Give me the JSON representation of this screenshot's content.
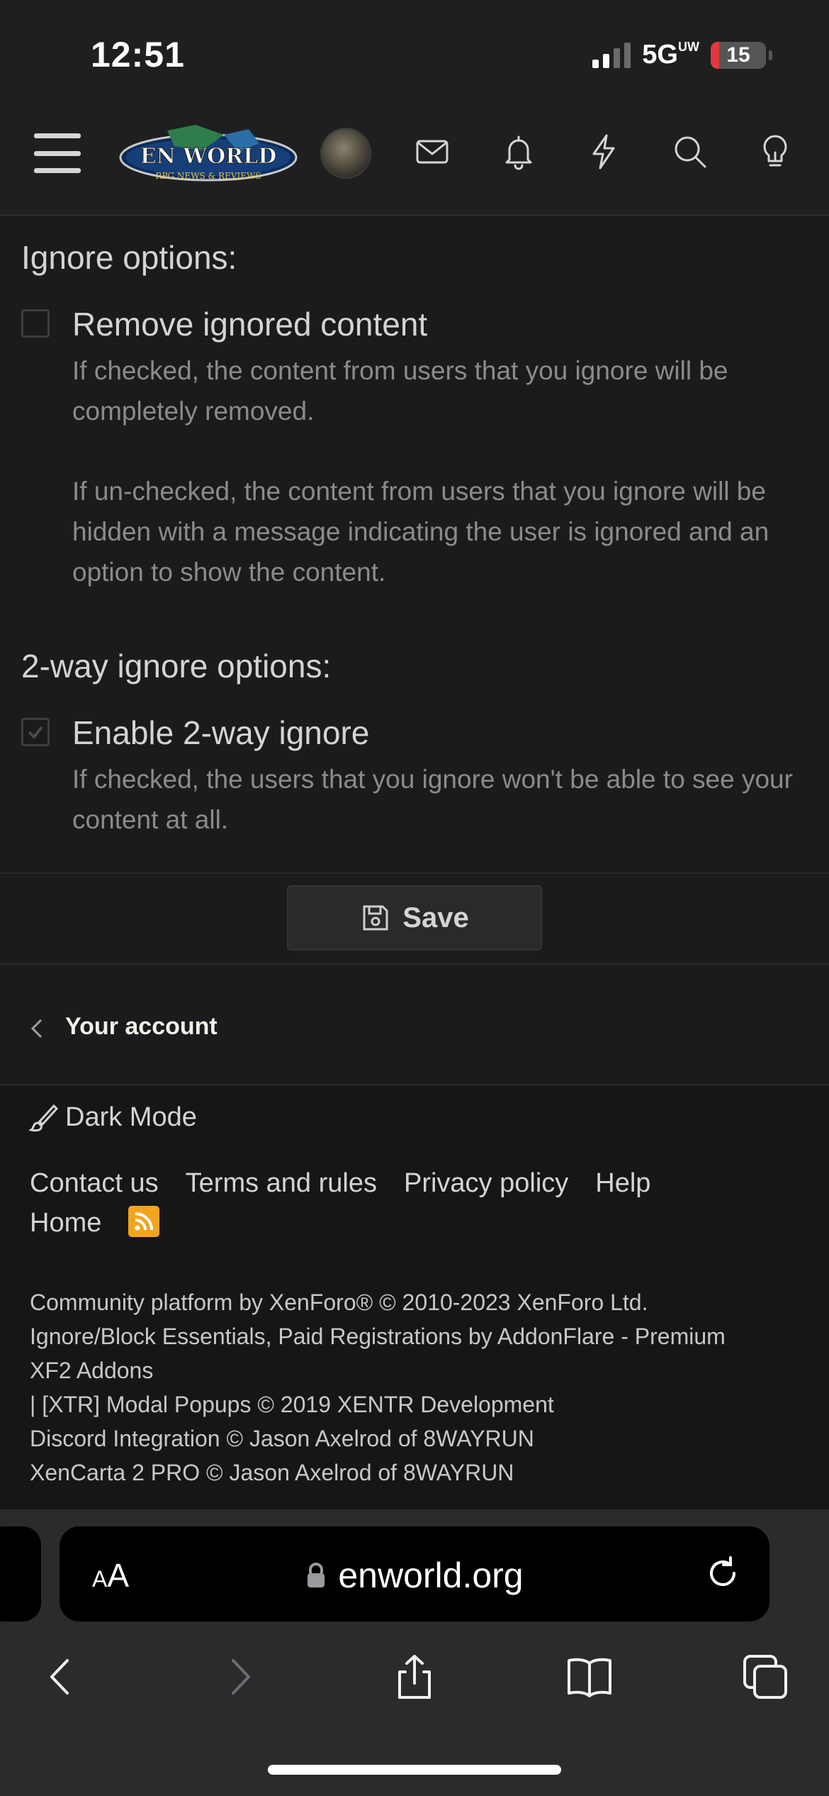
{
  "status_bar": {
    "time": "12:51",
    "network": "5G",
    "network_sup": "UW",
    "battery_percent": 15,
    "battery_label": "15"
  },
  "header": {
    "logo_alt": "EN WORLD RPG NEWS & REVIEWS",
    "icons": [
      "menu-icon",
      "avatar",
      "mail-icon",
      "bell-icon",
      "bolt-icon",
      "search-icon",
      "lightbulb-icon"
    ]
  },
  "ignore_options": {
    "title": "Ignore options:",
    "remove_label": "Remove ignored content",
    "remove_checked": false,
    "remove_desc_1": "If checked, the content from users that you ignore will be completely removed.",
    "remove_desc_2": "If un-checked, the content from users that you ignore will be hidden with a message indicating the user is ignored and an option to show the content."
  },
  "two_way": {
    "title": "2-way ignore options:",
    "enable_label": "Enable 2-way ignore",
    "enable_checked": true,
    "enable_desc": "If checked, the users that you ignore won't be able to see your content at all."
  },
  "actions": {
    "save_label": "Save"
  },
  "breadcrumb": {
    "account_label": "Your account"
  },
  "footer": {
    "dark_mode_label": "Dark Mode",
    "links": [
      "Contact us",
      "Terms and rules",
      "Privacy policy",
      "Help",
      "Home"
    ],
    "copyright_lines": [
      "Community platform by XenForo® © 2010-2023 XenForo Ltd.",
      "Ignore/Block Essentials, Paid Registrations by AddonFlare - Premium",
      "XF2 Addons",
      "| [XTR] Modal Popups © 2019 XENTR Development",
      "Discord Integration © Jason Axelrod of 8WAYRUN",
      "XenCarta 2 PRO © Jason Axelrod of 8WAYRUN"
    ]
  },
  "browser": {
    "text_size_label": "AA",
    "url": "enworld.org"
  },
  "colors": {
    "background": "#1b1b1c",
    "footer_bg": "#161617",
    "rss": "#f2a51c",
    "battery_low": "#e0393e"
  }
}
